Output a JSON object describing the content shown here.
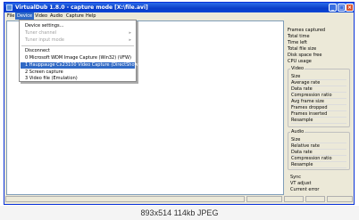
{
  "window": {
    "title": "VirtualDub 1.8.0 - capture mode [X:\\file.avi]",
    "minimize_icon": "minimize-icon",
    "maximize_icon": "maximize-icon",
    "close_icon": "close-icon"
  },
  "menu": {
    "items": [
      "File",
      "Device",
      "Video",
      "Audio",
      "Capture",
      "Help"
    ],
    "active": "Device"
  },
  "device_menu": {
    "items": [
      {
        "label": "Device settings...",
        "disabled": false,
        "arrow": ""
      },
      {
        "label": "Tuner channel",
        "disabled": true,
        "arrow": "▸"
      },
      {
        "label": "Tuner input mode",
        "disabled": true,
        "arrow": "▸"
      },
      {
        "label": "Disconnect",
        "disabled": false,
        "arrow": ""
      },
      {
        "label": "0 Microsoft WDM Image Capture (Win32) (VFW)",
        "disabled": false,
        "arrow": ""
      },
      {
        "label": "1 Hauppauge Cx23100 Video Capture (DirectShow)",
        "disabled": false,
        "arrow": "",
        "selected": true
      },
      {
        "label": "2 Screen capture",
        "disabled": false,
        "arrow": ""
      },
      {
        "label": "3 Video file (Emulation)",
        "disabled": false,
        "arrow": ""
      }
    ]
  },
  "stats": [
    "Frames captured",
    "Total time",
    "Time left",
    "Total file size",
    "Disk space free",
    "CPU usage"
  ],
  "video_group": {
    "title": "Video",
    "rows": [
      "Size",
      "Average rate",
      "Data rate",
      "Compression ratio",
      "Avg frame size",
      "Frames dropped",
      "Frames inserted",
      "Resample"
    ]
  },
  "audio_group": {
    "title": "Audio",
    "rows": [
      "Size",
      "Relative rate",
      "Data rate",
      "Compression ratio",
      "Resample"
    ]
  },
  "sync_group": {
    "title": "Sync",
    "rows": [
      "VT adjust",
      "Current error"
    ]
  },
  "caption": "893x514  114kb  JPEG"
}
